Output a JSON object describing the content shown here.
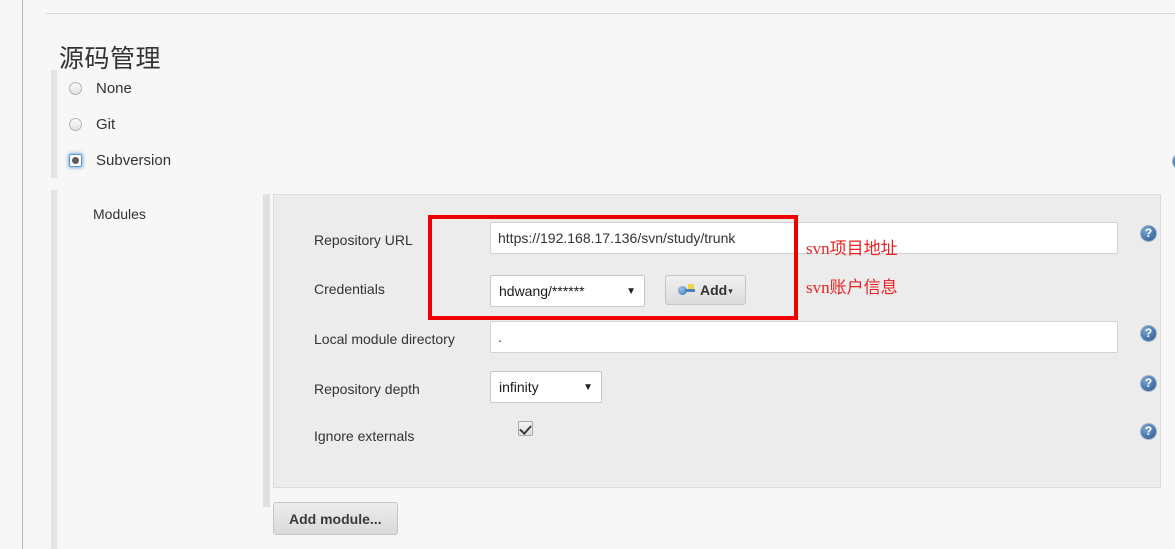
{
  "page": {
    "title": "源码管理"
  },
  "scm": {
    "options": [
      {
        "label": "None",
        "selected": false
      },
      {
        "label": "Git",
        "selected": false
      },
      {
        "label": "Subversion",
        "selected": true
      }
    ],
    "help_icon": "help-icon",
    "help_glyph": "?"
  },
  "modules": {
    "section_label": "Modules",
    "add_module_label": "Add module...",
    "fields": [
      {
        "label": "Repository URL",
        "type": "text",
        "value": "https://192.168.17.136/svn/study/trunk",
        "help_glyph": "?"
      },
      {
        "label": "Credentials",
        "type": "select",
        "value": "hdwang/******",
        "arrow_glyph": "▼",
        "help_glyph": ""
      },
      {
        "label": "Local module directory",
        "type": "text",
        "value": ".",
        "help_glyph": "?"
      },
      {
        "label": "Repository depth",
        "type": "select",
        "value": "infinity",
        "arrow_glyph": "▼",
        "help_glyph": "?"
      },
      {
        "label": "Ignore externals",
        "type": "checkbox",
        "value": "checked",
        "help_glyph": "?"
      }
    ],
    "add_credentials": {
      "label": "Add",
      "caret_glyph": "▾",
      "icon": "key-icon"
    }
  },
  "annotations": {
    "box_color": "#ee0000",
    "text_color": "#ee2222",
    "items": [
      {
        "text": "svn项目地址"
      },
      {
        "text": "svn账户信息"
      }
    ]
  }
}
